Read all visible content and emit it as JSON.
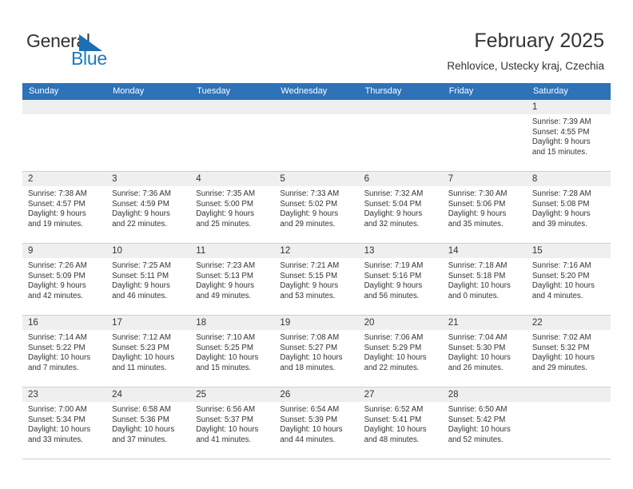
{
  "logo": {
    "word1": "General",
    "word2": "Blue",
    "flag_icon": "blue-triangle-flag-icon",
    "word1_color": "#333333",
    "word2_color": "#1a7bc4"
  },
  "header": {
    "title": "February 2025",
    "subtitle": "Rehlovice, Ustecky kraj, Czechia"
  },
  "colors": {
    "header_blue": "#2e72b8",
    "day_band_gray": "#efefef",
    "grid_line": "#cfcfcf",
    "text": "#333333"
  },
  "weekdays": [
    "Sunday",
    "Monday",
    "Tuesday",
    "Wednesday",
    "Thursday",
    "Friday",
    "Saturday"
  ],
  "weeks": [
    [
      {
        "day": "",
        "empty": true,
        "sunrise": "",
        "sunset": "",
        "daylight1": "",
        "daylight2": ""
      },
      {
        "day": "",
        "empty": true,
        "sunrise": "",
        "sunset": "",
        "daylight1": "",
        "daylight2": ""
      },
      {
        "day": "",
        "empty": true,
        "sunrise": "",
        "sunset": "",
        "daylight1": "",
        "daylight2": ""
      },
      {
        "day": "",
        "empty": true,
        "sunrise": "",
        "sunset": "",
        "daylight1": "",
        "daylight2": ""
      },
      {
        "day": "",
        "empty": true,
        "sunrise": "",
        "sunset": "",
        "daylight1": "",
        "daylight2": ""
      },
      {
        "day": "",
        "empty": true,
        "sunrise": "",
        "sunset": "",
        "daylight1": "",
        "daylight2": ""
      },
      {
        "day": "1",
        "empty": false,
        "sunrise": "Sunrise: 7:39 AM",
        "sunset": "Sunset: 4:55 PM",
        "daylight1": "Daylight: 9 hours",
        "daylight2": "and 15 minutes."
      }
    ],
    [
      {
        "day": "2",
        "empty": false,
        "sunrise": "Sunrise: 7:38 AM",
        "sunset": "Sunset: 4:57 PM",
        "daylight1": "Daylight: 9 hours",
        "daylight2": "and 19 minutes."
      },
      {
        "day": "3",
        "empty": false,
        "sunrise": "Sunrise: 7:36 AM",
        "sunset": "Sunset: 4:59 PM",
        "daylight1": "Daylight: 9 hours",
        "daylight2": "and 22 minutes."
      },
      {
        "day": "4",
        "empty": false,
        "sunrise": "Sunrise: 7:35 AM",
        "sunset": "Sunset: 5:00 PM",
        "daylight1": "Daylight: 9 hours",
        "daylight2": "and 25 minutes."
      },
      {
        "day": "5",
        "empty": false,
        "sunrise": "Sunrise: 7:33 AM",
        "sunset": "Sunset: 5:02 PM",
        "daylight1": "Daylight: 9 hours",
        "daylight2": "and 29 minutes."
      },
      {
        "day": "6",
        "empty": false,
        "sunrise": "Sunrise: 7:32 AM",
        "sunset": "Sunset: 5:04 PM",
        "daylight1": "Daylight: 9 hours",
        "daylight2": "and 32 minutes."
      },
      {
        "day": "7",
        "empty": false,
        "sunrise": "Sunrise: 7:30 AM",
        "sunset": "Sunset: 5:06 PM",
        "daylight1": "Daylight: 9 hours",
        "daylight2": "and 35 minutes."
      },
      {
        "day": "8",
        "empty": false,
        "sunrise": "Sunrise: 7:28 AM",
        "sunset": "Sunset: 5:08 PM",
        "daylight1": "Daylight: 9 hours",
        "daylight2": "and 39 minutes."
      }
    ],
    [
      {
        "day": "9",
        "empty": false,
        "sunrise": "Sunrise: 7:26 AM",
        "sunset": "Sunset: 5:09 PM",
        "daylight1": "Daylight: 9 hours",
        "daylight2": "and 42 minutes."
      },
      {
        "day": "10",
        "empty": false,
        "sunrise": "Sunrise: 7:25 AM",
        "sunset": "Sunset: 5:11 PM",
        "daylight1": "Daylight: 9 hours",
        "daylight2": "and 46 minutes."
      },
      {
        "day": "11",
        "empty": false,
        "sunrise": "Sunrise: 7:23 AM",
        "sunset": "Sunset: 5:13 PM",
        "daylight1": "Daylight: 9 hours",
        "daylight2": "and 49 minutes."
      },
      {
        "day": "12",
        "empty": false,
        "sunrise": "Sunrise: 7:21 AM",
        "sunset": "Sunset: 5:15 PM",
        "daylight1": "Daylight: 9 hours",
        "daylight2": "and 53 minutes."
      },
      {
        "day": "13",
        "empty": false,
        "sunrise": "Sunrise: 7:19 AM",
        "sunset": "Sunset: 5:16 PM",
        "daylight1": "Daylight: 9 hours",
        "daylight2": "and 56 minutes."
      },
      {
        "day": "14",
        "empty": false,
        "sunrise": "Sunrise: 7:18 AM",
        "sunset": "Sunset: 5:18 PM",
        "daylight1": "Daylight: 10 hours",
        "daylight2": "and 0 minutes."
      },
      {
        "day": "15",
        "empty": false,
        "sunrise": "Sunrise: 7:16 AM",
        "sunset": "Sunset: 5:20 PM",
        "daylight1": "Daylight: 10 hours",
        "daylight2": "and 4 minutes."
      }
    ],
    [
      {
        "day": "16",
        "empty": false,
        "sunrise": "Sunrise: 7:14 AM",
        "sunset": "Sunset: 5:22 PM",
        "daylight1": "Daylight: 10 hours",
        "daylight2": "and 7 minutes."
      },
      {
        "day": "17",
        "empty": false,
        "sunrise": "Sunrise: 7:12 AM",
        "sunset": "Sunset: 5:23 PM",
        "daylight1": "Daylight: 10 hours",
        "daylight2": "and 11 minutes."
      },
      {
        "day": "18",
        "empty": false,
        "sunrise": "Sunrise: 7:10 AM",
        "sunset": "Sunset: 5:25 PM",
        "daylight1": "Daylight: 10 hours",
        "daylight2": "and 15 minutes."
      },
      {
        "day": "19",
        "empty": false,
        "sunrise": "Sunrise: 7:08 AM",
        "sunset": "Sunset: 5:27 PM",
        "daylight1": "Daylight: 10 hours",
        "daylight2": "and 18 minutes."
      },
      {
        "day": "20",
        "empty": false,
        "sunrise": "Sunrise: 7:06 AM",
        "sunset": "Sunset: 5:29 PM",
        "daylight1": "Daylight: 10 hours",
        "daylight2": "and 22 minutes."
      },
      {
        "day": "21",
        "empty": false,
        "sunrise": "Sunrise: 7:04 AM",
        "sunset": "Sunset: 5:30 PM",
        "daylight1": "Daylight: 10 hours",
        "daylight2": "and 26 minutes."
      },
      {
        "day": "22",
        "empty": false,
        "sunrise": "Sunrise: 7:02 AM",
        "sunset": "Sunset: 5:32 PM",
        "daylight1": "Daylight: 10 hours",
        "daylight2": "and 29 minutes."
      }
    ],
    [
      {
        "day": "23",
        "empty": false,
        "sunrise": "Sunrise: 7:00 AM",
        "sunset": "Sunset: 5:34 PM",
        "daylight1": "Daylight: 10 hours",
        "daylight2": "and 33 minutes."
      },
      {
        "day": "24",
        "empty": false,
        "sunrise": "Sunrise: 6:58 AM",
        "sunset": "Sunset: 5:36 PM",
        "daylight1": "Daylight: 10 hours",
        "daylight2": "and 37 minutes."
      },
      {
        "day": "25",
        "empty": false,
        "sunrise": "Sunrise: 6:56 AM",
        "sunset": "Sunset: 5:37 PM",
        "daylight1": "Daylight: 10 hours",
        "daylight2": "and 41 minutes."
      },
      {
        "day": "26",
        "empty": false,
        "sunrise": "Sunrise: 6:54 AM",
        "sunset": "Sunset: 5:39 PM",
        "daylight1": "Daylight: 10 hours",
        "daylight2": "and 44 minutes."
      },
      {
        "day": "27",
        "empty": false,
        "sunrise": "Sunrise: 6:52 AM",
        "sunset": "Sunset: 5:41 PM",
        "daylight1": "Daylight: 10 hours",
        "daylight2": "and 48 minutes."
      },
      {
        "day": "28",
        "empty": false,
        "sunrise": "Sunrise: 6:50 AM",
        "sunset": "Sunset: 5:42 PM",
        "daylight1": "Daylight: 10 hours",
        "daylight2": "and 52 minutes."
      },
      {
        "day": "",
        "empty": true,
        "sunrise": "",
        "sunset": "",
        "daylight1": "",
        "daylight2": ""
      }
    ]
  ]
}
